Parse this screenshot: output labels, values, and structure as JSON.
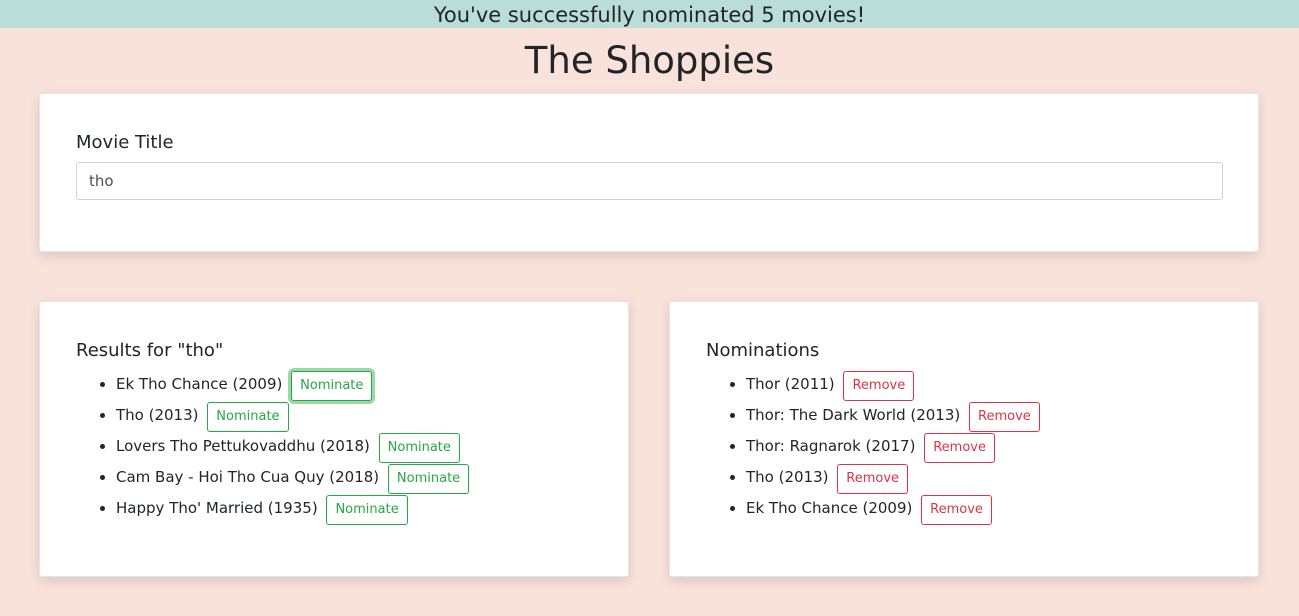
{
  "banner": {
    "message": "You've successfully nominated 5 movies!"
  },
  "app": {
    "title": "The Shoppies"
  },
  "search": {
    "label": "Movie Title",
    "value": "tho"
  },
  "results": {
    "heading": "Results for \"tho\"",
    "button_label": "Nominate",
    "items": [
      {
        "title": "Ek Tho Chance (2009)"
      },
      {
        "title": "Tho (2013)"
      },
      {
        "title": "Lovers Tho Pettukovaddhu (2018)"
      },
      {
        "title": "Cam Bay - Hoi Tho Cua Quy (2018)"
      },
      {
        "title": "Happy Tho' Married (1935)"
      }
    ]
  },
  "nominations": {
    "heading": "Nominations",
    "button_label": "Remove",
    "items": [
      {
        "title": "Thor (2011)"
      },
      {
        "title": "Thor: The Dark World (2013)"
      },
      {
        "title": "Thor: Ragnarok (2017)"
      },
      {
        "title": "Tho (2013)"
      },
      {
        "title": "Ek Tho Chance (2009)"
      }
    ]
  },
  "colors": {
    "background": "#f9e2da",
    "banner": "#b9ded8",
    "nominate": "#28a745",
    "remove": "#dc3545"
  }
}
